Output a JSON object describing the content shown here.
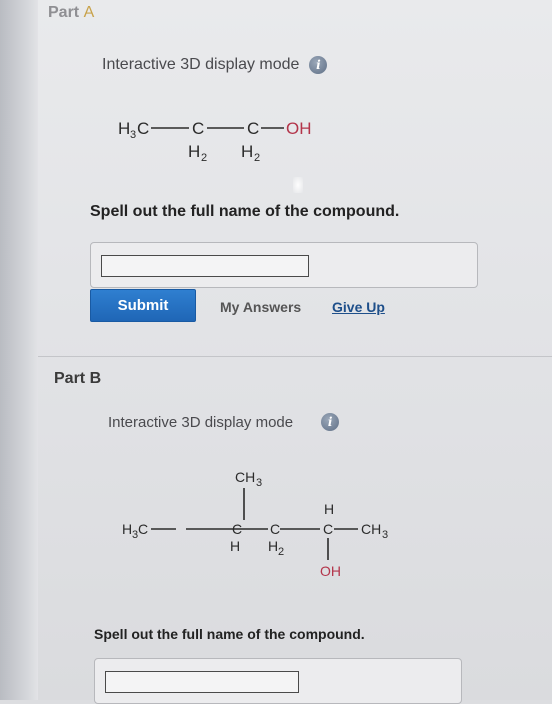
{
  "part_a": {
    "title_prefix": "Part ",
    "title_letter": "A",
    "mode_text": "Interactive 3D display mode",
    "info_icon_glyph": "i",
    "molecule": {
      "c1": "H",
      "c1_sub": "3",
      "c1_tail": "C",
      "c2": "C",
      "c2_below": "H",
      "c2_below_sub": "2",
      "c3": "C",
      "c3_below": "H",
      "c3_below_sub": "2",
      "oh": "OH"
    },
    "prompt": "Spell out the full name of the compound.",
    "answer_value": "",
    "submit_label": "Submit",
    "my_answers_label": "My Answers",
    "give_up_label": "Give Up"
  },
  "part_b": {
    "title": "Part B",
    "mode_text": "Interactive 3D display mode",
    "info_icon_glyph": "i",
    "molecule": {
      "left": "H",
      "left_sub": "3",
      "left_tail": "C",
      "top_ch3": "CH",
      "top_ch3_sub": "3",
      "c2": "C",
      "c2_below": "H",
      "c3": "C",
      "c3_below": "H",
      "c3_below_sub": "2",
      "c4_top": "H",
      "c4": "C",
      "right": "CH",
      "right_sub": "3",
      "oh": "OH"
    },
    "prompt": "Spell out the full name of the compound.",
    "answer_value": ""
  },
  "colors": {
    "submit_bg": "#2a76c6",
    "link_blue": "#1e4f8a",
    "oh_red": "#b3344a",
    "part_a_letter": "#c8a24a"
  }
}
